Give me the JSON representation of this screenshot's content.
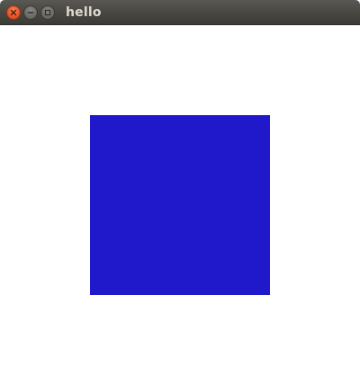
{
  "window": {
    "title": "hello"
  },
  "titlebar_buttons": {
    "close": "close-icon",
    "minimize": "minimize-icon",
    "maximize": "maximize-icon"
  },
  "canvas": {
    "background_color": "#ffffff",
    "square_color": "#1f19cb"
  }
}
